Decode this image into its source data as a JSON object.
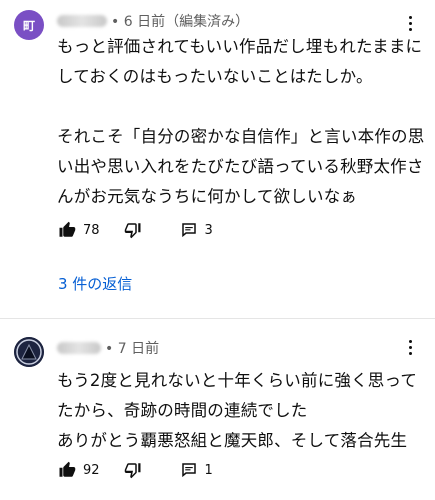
{
  "comments": [
    {
      "avatar_text": "町",
      "timestamp": "• 6 日前（編集済み）",
      "text": "もっと評価されてもいい作品だし埋もれたままにしておくのはもったいないことはたしか。\n\nそれこそ「自分の密かな自信作」と言い本作の思い出や思い入れをたびたび語っている秋野太作さんがお元気なうちに何かして欲しいなぁ",
      "likes": "78",
      "replies_count": "3",
      "view_replies": "3 件の返信"
    },
    {
      "timestamp": "• 7 日前",
      "text": "もう2度と見れないと十年くらい前に強く思ってたから、奇跡の時間の連続でした\nありがとう覇悪怒組と魔天郎、そして落合先生",
      "likes": "92",
      "replies_count": "1"
    }
  ],
  "colors": {
    "avatar_purple": "#7a4fc4",
    "link_blue": "#065fd4",
    "meta_gray": "#606060"
  }
}
